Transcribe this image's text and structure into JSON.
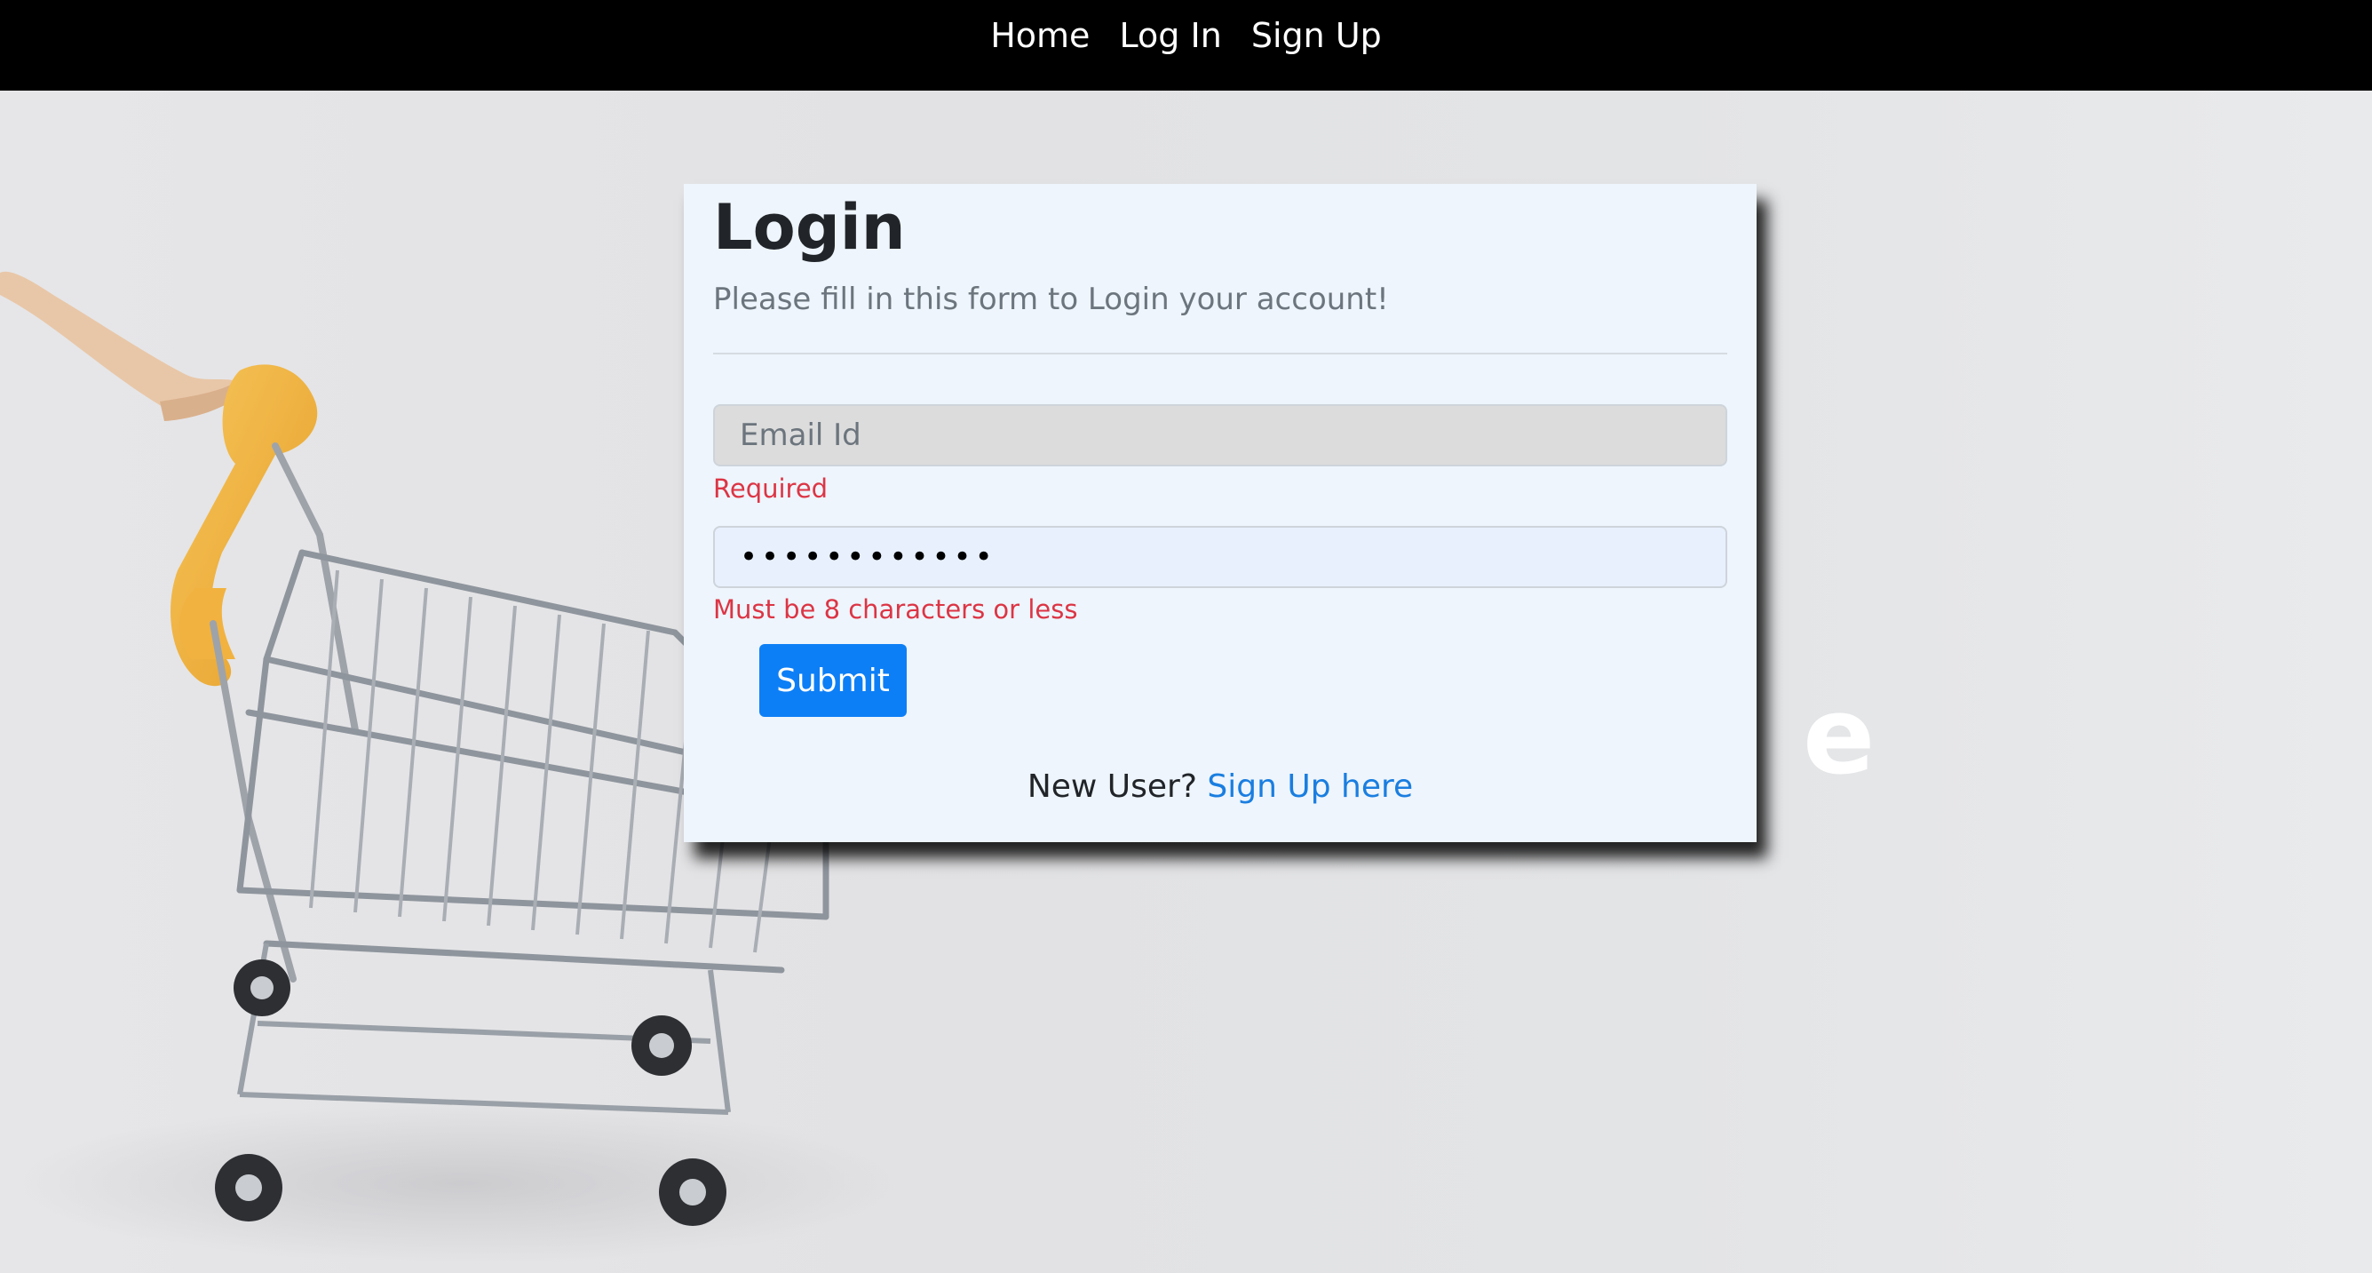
{
  "nav": {
    "items": [
      {
        "label": "Home"
      },
      {
        "label": "Log In"
      },
      {
        "label": "Sign Up"
      }
    ]
  },
  "background": {
    "letter": "e"
  },
  "login_form": {
    "title": "Login",
    "subtitle": "Please fill in this form to Login your account!",
    "email": {
      "placeholder": "Email Id",
      "value": "",
      "error": "Required"
    },
    "password": {
      "value": "••••••••••••",
      "error": "Must be 8 characters or less"
    },
    "submit_label": "Submit",
    "signup_prompt": "New User?",
    "signup_link": "Sign Up here"
  },
  "colors": {
    "navbar": "#000000",
    "card": "#eef5fc",
    "primary_button": "#0d7ff6",
    "error": "#dc3545",
    "link": "#1a7ee0",
    "cart_handle": "#f0b43c"
  },
  "icons": {
    "background_image": "shopping-cart-image"
  }
}
